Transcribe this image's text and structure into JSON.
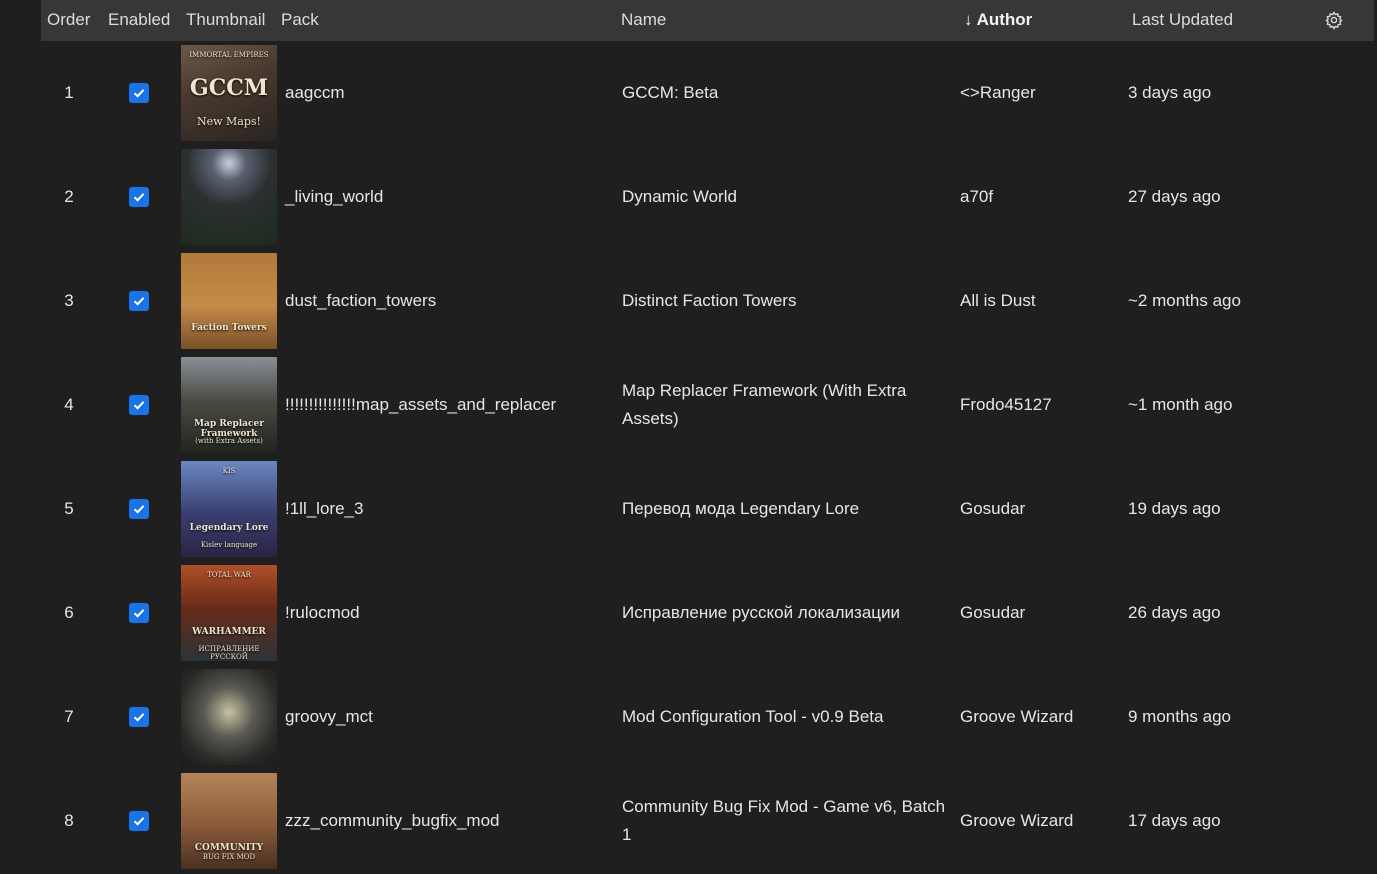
{
  "header": {
    "order": "Order",
    "enabled": "Enabled",
    "thumbnail": "Thumbnail",
    "pack": "Pack",
    "name": "Name",
    "author": "↓ Author",
    "last_updated": "Last Updated",
    "settings_icon": "gear-icon"
  },
  "colors": {
    "background": "#1f1f1f",
    "header_bg": "#373737",
    "checkbox": "#1a73e8",
    "text": "#e6e6e6"
  },
  "rows": [
    {
      "order": "1",
      "enabled": true,
      "pack": "aagccm",
      "name": "GCCM: Beta",
      "author": "<>Ranger",
      "updated": "3 days ago",
      "thumb_text": "GCCM",
      "thumb_sub": "New Maps!",
      "thumb_tag": "IMMORTAL EMPIRES"
    },
    {
      "order": "2",
      "enabled": true,
      "pack": "_living_world",
      "name": "Dynamic World",
      "author": "a70f",
      "updated": "27 days ago",
      "thumb_text": "",
      "thumb_sub": "",
      "thumb_tag": ""
    },
    {
      "order": "3",
      "enabled": true,
      "pack": "dust_faction_towers",
      "name": "Distinct Faction Towers",
      "author": "All is Dust",
      "updated": "~2 months ago",
      "thumb_text": "Faction Towers",
      "thumb_sub": "",
      "thumb_tag": ""
    },
    {
      "order": "4",
      "enabled": true,
      "pack": "!!!!!!!!!!!!!!!map_assets_and_replacer",
      "name": "Map Replacer Framework (With Extra Assets)",
      "author": "Frodo45127",
      "updated": "~1 month ago",
      "thumb_text": "Map Replacer Framework",
      "thumb_sub": "(with Extra Assets)",
      "thumb_tag": ""
    },
    {
      "order": "5",
      "enabled": true,
      "pack": "!1ll_lore_3",
      "name": "Перевод мода Legendary Lore",
      "author": "Gosudar",
      "updated": "19 days ago",
      "thumb_text": "Legendary Lore",
      "thumb_sub": "Kislev language",
      "thumb_tag": "KIS"
    },
    {
      "order": "6",
      "enabled": true,
      "pack": "!rulocmod",
      "name": "Исправление русской локализации",
      "author": "Gosudar",
      "updated": "26 days ago",
      "thumb_text": "WARHAMMER",
      "thumb_sub": "ИСПРАВЛЕНИЕ РУССКОЙ ЛОКАЛИЗАЦИИ",
      "thumb_tag": "TOTAL WAR"
    },
    {
      "order": "7",
      "enabled": true,
      "pack": "groovy_mct",
      "name": "Mod Configuration Tool - v0.9 Beta",
      "author": "Groove Wizard",
      "updated": "9 months ago",
      "thumb_text": "",
      "thumb_sub": "",
      "thumb_tag": ""
    },
    {
      "order": "8",
      "enabled": true,
      "pack": "zzz_community_bugfix_mod",
      "name": "Community Bug Fix Mod - Game v6, Batch 1",
      "author": "Groove Wizard",
      "updated": "17 days ago",
      "thumb_text": "COMMUNITY",
      "thumb_sub": "BUG FIX MOD",
      "thumb_tag": ""
    }
  ]
}
